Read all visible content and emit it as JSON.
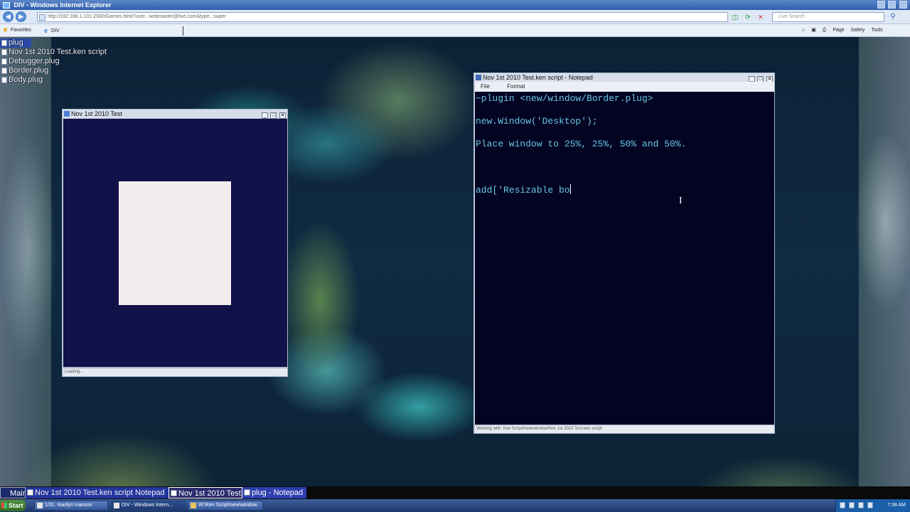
{
  "browser": {
    "title": "DIV - Windows Internet Explorer",
    "address": "http://192.168.1.101:2500/Games.html?user...webmaster@live.com&type...super",
    "search_placeholder": "Live Search",
    "favorites_label": "Favorites",
    "tab_label": "DIV",
    "command_bar": [
      "Page",
      "Safety",
      "Tools"
    ]
  },
  "file_list": [
    "plug",
    "Nov 1st 2010 Test.ken script",
    "Debugger.plug",
    "Border.plug",
    "Body.plug"
  ],
  "test_window": {
    "title": "Nov 1st 2010 Test",
    "status": "Loading..."
  },
  "notepad": {
    "title": "Nov 1st 2010 Test.ken script - Notepad",
    "menu": [
      "File",
      "Format"
    ],
    "lines": [
      "~plugin <new/window/Border.plug>",
      "new.Window('Desktop');",
      "Place window to 25%, 25%, 50% and 50%.",
      "add['Resizable bo"
    ],
    "status": "Working with: Ken Script/new/window/Nov 1st 2010 Test.ken script"
  },
  "app_taskbar": {
    "items": [
      "Main",
      "Nov 1st 2010 Test.ken script   Notepad",
      "Nov 1st 2010 Test",
      "plug - Notepad"
    ]
  },
  "taskbar": {
    "start": "Start",
    "buttons": [
      "1/31. marilyn manson",
      "DIV - Windows Intern...",
      "W:\\Ken Script\\new\\window"
    ],
    "clock": "7:38 AM"
  }
}
